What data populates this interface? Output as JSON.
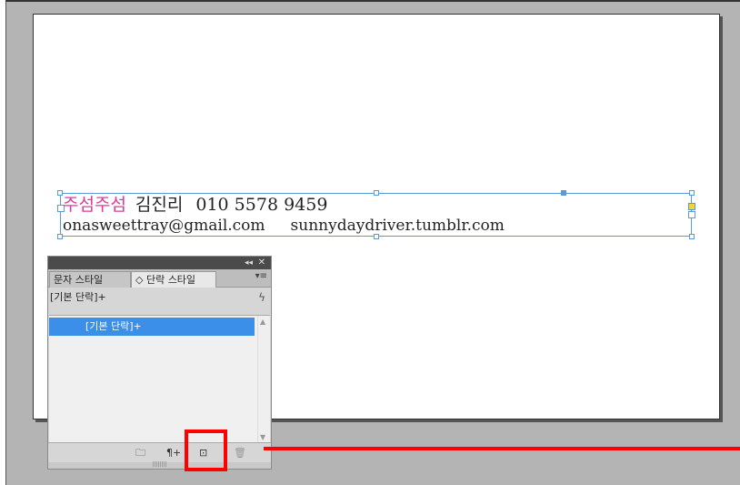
{
  "document": {
    "line1": {
      "brand": "주섬주섬",
      "name": "김진리",
      "phone": "010 5578 9459"
    },
    "line2": {
      "email": "onasweettray@gmail.com",
      "site": "sunnydaydriver.tumblr.com"
    }
  },
  "panel": {
    "topbar": {
      "collapse": "◂◂",
      "close": "✕"
    },
    "tabs": [
      {
        "label": "문자 스타일"
      },
      {
        "label": "◇ 단락 스타일"
      }
    ],
    "menu_icon": "▾≡",
    "current_style": "[기본 단락]+",
    "lightning_icon": "ϟ",
    "list_items": [
      {
        "label": "[기본 단락]+"
      }
    ],
    "footer_icons": [
      {
        "name": "folder-icon",
        "glyph": "🗀"
      },
      {
        "name": "paragraph-override-icon",
        "glyph": "¶+"
      },
      {
        "name": "new-style-icon",
        "glyph": "⊡"
      },
      {
        "name": "trash-icon",
        "glyph": "🗑"
      }
    ]
  },
  "colors": {
    "accent": "#e0389b",
    "selection": "#3b8fe8",
    "highlight": "#ff0000"
  }
}
